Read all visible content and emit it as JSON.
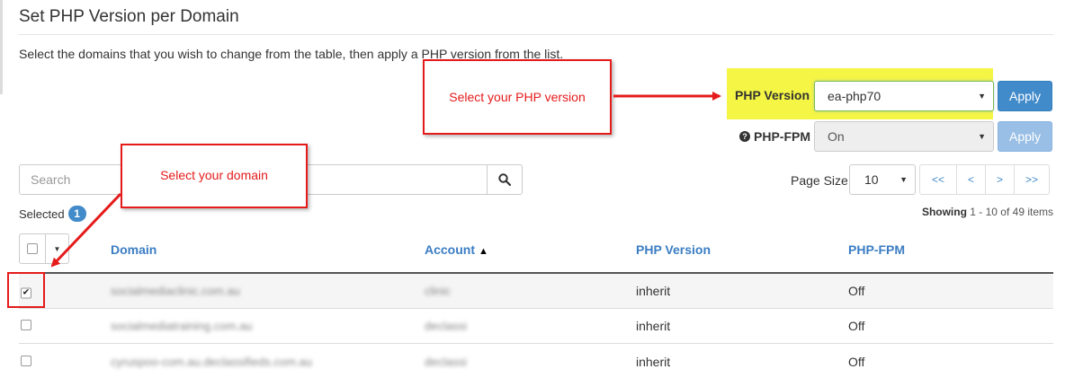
{
  "page": {
    "title": "Set PHP Version per Domain",
    "description": "Select the domains that you wish to change from the table, then apply a PHP version from the list."
  },
  "php_version": {
    "label": "PHP Version",
    "selected": "ea-php70",
    "apply_label": "Apply"
  },
  "php_fpm": {
    "label": "PHP-FPM",
    "selected": "On",
    "apply_label": "Apply"
  },
  "search": {
    "placeholder": "Search"
  },
  "selection": {
    "label": "Selected",
    "count": "1"
  },
  "pagination": {
    "page_size_label": "Page Size",
    "page_size": "10",
    "first": "<<",
    "prev": "<",
    "next": ">",
    "last": ">>",
    "showing_label": "Showing",
    "showing_range": "1 - 10 of 49 items"
  },
  "table": {
    "columns": [
      "Domain",
      "Account",
      "PHP Version",
      "PHP-FPM"
    ],
    "sort_indicator": "▲",
    "rows": [
      {
        "checked": true,
        "domain": "socialmediaclinic.com.au",
        "account": "clinic",
        "php_version": "inherit",
        "php_fpm": "Off"
      },
      {
        "checked": false,
        "domain": "socialmediatraining.com.au",
        "account": "declassi",
        "php_version": "inherit",
        "php_fpm": "Off"
      },
      {
        "checked": false,
        "domain": "cyruspoo-com.au.declassifieds.com.au",
        "account": "declassi",
        "php_version": "inherit",
        "php_fpm": "Off"
      }
    ]
  },
  "annotations": {
    "php_callout": "Select your PHP version",
    "domain_callout": "Select your domain",
    "color": "#e51b1b",
    "highlight_color": "#f5f545"
  },
  "colors": {
    "primary": "#428bca",
    "link": "#3b7dc4"
  }
}
